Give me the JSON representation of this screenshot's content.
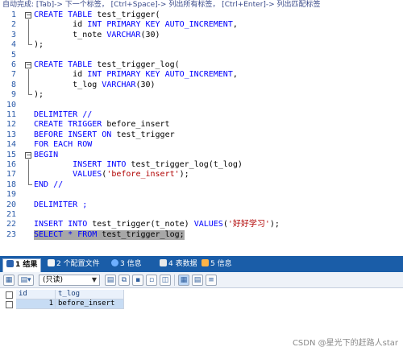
{
  "hint": "自动完成: [Tab]-> 下一个标签， [Ctrl+Space]-> 列出所有标签， [Ctrl+Enter]-> 列出匹配标签",
  "code": {
    "lines": [
      {
        "n": "1",
        "parts": [
          {
            "t": "CREATE TABLE ",
            "c": "kw"
          },
          {
            "t": "test_trigger(",
            "c": "sym"
          }
        ]
      },
      {
        "n": "2",
        "parts": [
          {
            "t": "        id ",
            "c": "sym"
          },
          {
            "t": "INT PRIMARY KEY AUTO_INCREMENT",
            "c": "kw"
          },
          {
            "t": ",",
            "c": "sym"
          }
        ]
      },
      {
        "n": "3",
        "parts": [
          {
            "t": "        t_note ",
            "c": "sym"
          },
          {
            "t": "VARCHAR",
            "c": "kw"
          },
          {
            "t": "(30)",
            "c": "sym"
          }
        ]
      },
      {
        "n": "4",
        "parts": [
          {
            "t": ");",
            "c": "sym"
          }
        ]
      },
      {
        "n": "5",
        "parts": []
      },
      {
        "n": "6",
        "parts": [
          {
            "t": "CREATE TABLE ",
            "c": "kw"
          },
          {
            "t": "test_trigger_log(",
            "c": "sym"
          }
        ]
      },
      {
        "n": "7",
        "parts": [
          {
            "t": "        id ",
            "c": "sym"
          },
          {
            "t": "INT PRIMARY KEY AUTO_INCREMENT",
            "c": "kw"
          },
          {
            "t": ",",
            "c": "sym"
          }
        ]
      },
      {
        "n": "8",
        "parts": [
          {
            "t": "        t_log ",
            "c": "sym"
          },
          {
            "t": "VARCHAR",
            "c": "kw"
          },
          {
            "t": "(30)",
            "c": "sym"
          }
        ]
      },
      {
        "n": "9",
        "parts": [
          {
            "t": ");",
            "c": "sym"
          }
        ]
      },
      {
        "n": "10",
        "parts": []
      },
      {
        "n": "11",
        "parts": [
          {
            "t": "DELIMITER //",
            "c": "kw"
          }
        ]
      },
      {
        "n": "12",
        "parts": [
          {
            "t": "CREATE TRIGGER ",
            "c": "kw"
          },
          {
            "t": "before_insert",
            "c": "sym"
          }
        ]
      },
      {
        "n": "13",
        "parts": [
          {
            "t": "BEFORE INSERT ON ",
            "c": "kw"
          },
          {
            "t": "test_trigger",
            "c": "sym"
          }
        ]
      },
      {
        "n": "14",
        "parts": [
          {
            "t": "FOR EACH ROW",
            "c": "kw"
          }
        ]
      },
      {
        "n": "15",
        "parts": [
          {
            "t": "BEGIN",
            "c": "kw"
          }
        ]
      },
      {
        "n": "16",
        "parts": [
          {
            "t": "        INSERT INTO ",
            "c": "kw"
          },
          {
            "t": "test_trigger_log(t_log)",
            "c": "sym"
          }
        ]
      },
      {
        "n": "17",
        "parts": [
          {
            "t": "        VALUES",
            "c": "kw"
          },
          {
            "t": "(",
            "c": "sym"
          },
          {
            "t": "'before_insert'",
            "c": "str"
          },
          {
            "t": ");",
            "c": "sym"
          }
        ]
      },
      {
        "n": "18",
        "parts": [
          {
            "t": "END //",
            "c": "kw"
          }
        ]
      },
      {
        "n": "19",
        "parts": []
      },
      {
        "n": "20",
        "parts": [
          {
            "t": "DELIMITER ;",
            "c": "kw"
          }
        ]
      },
      {
        "n": "21",
        "parts": []
      },
      {
        "n": "22",
        "parts": [
          {
            "t": "INSERT INTO ",
            "c": "kw"
          },
          {
            "t": "test_trigger(t_note) ",
            "c": "sym"
          },
          {
            "t": "VALUES",
            "c": "kw"
          },
          {
            "t": "(",
            "c": "sym"
          },
          {
            "t": "'好好学习'",
            "c": "str"
          },
          {
            "t": ");",
            "c": "sym"
          }
        ]
      },
      {
        "n": "23",
        "parts": [
          {
            "t": "SELECT * FROM ",
            "c": "kw"
          },
          {
            "t": "test_trigger_log;",
            "c": "sym"
          }
        ],
        "selected": true
      }
    ]
  },
  "result_tabs": [
    {
      "label": "1 结果",
      "active": true,
      "color": "#2a63b0"
    },
    {
      "label": "2 个配置文件",
      "active": false,
      "color": "#f4f4f4"
    },
    {
      "label": "3 信息",
      "active": false,
      "color": "#6fb0ff"
    },
    {
      "label": "4 表数据",
      "active": false,
      "color": "#e8e8e8"
    },
    {
      "label": "5 信息",
      "active": false,
      "color": "#ffb347"
    }
  ],
  "toolbar": {
    "mode_value": "(只读)"
  },
  "grid": {
    "columns": [
      "id",
      "t_log"
    ],
    "rows": [
      [
        "1",
        "before_insert"
      ]
    ]
  },
  "watermark": "CSDN @星光下的赶路人star"
}
